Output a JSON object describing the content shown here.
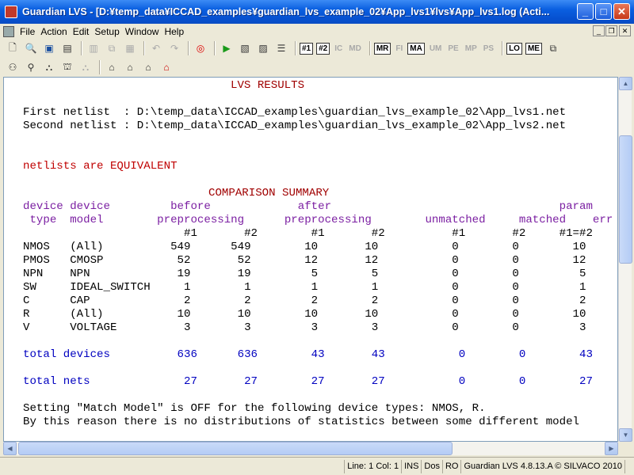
{
  "window": {
    "title": "Guardian LVS - [D:¥temp_data¥ICCAD_examples¥guardian_lvs_example_02¥App_lvs1¥lvs¥App_lvs1.log (Acti..."
  },
  "menu": [
    "File",
    "Action",
    "Edit",
    "Setup",
    "Window",
    "Help"
  ],
  "toolbar": {
    "text_buttons": [
      "#1",
      "#2",
      "IC",
      "MD",
      "MR",
      "FI",
      "MA",
      "UM",
      "PE",
      "MP",
      "PS",
      "LO",
      "ME"
    ]
  },
  "report": {
    "header": "LVS RESULTS",
    "first_netlist": "First netlist  : D:\\temp_data\\ICCAD_examples\\guardian_lvs_example_02\\App_lvs1.net",
    "second_netlist": "Second netlist : D:\\temp_data\\ICCAD_examples\\guardian_lvs_example_02\\App_lvs2.net",
    "status": "netlists are EQUIVALENT",
    "summary_title": "COMPARISON SUMMARY",
    "col_head_1": "device device         before             after                                  param",
    "col_head_2": " type  model        preprocessing      preprocessing        unmatched     matched    err",
    "col_head_3": "                        #1       #2        #1       #2          #1       #2     #1=#2    #1=",
    "rows": [
      "NMOS   (All)          549      549        10       10           0        0        10      0",
      "PMOS   CMOSP           52       52        12       12           0        0        12      0",
      "NPN    NPN             19       19         5        5           0        0         5      0",
      "SW     IDEAL_SWITCH     1        1         1        1           0        0         1      0",
      "C      CAP              2        2         2        2           0        0         2      0",
      "R      (All)           10       10        10       10           0        0        10      0",
      "V      VOLTAGE          3        3         3        3           0        0         3      0"
    ],
    "total_devices": "total devices          636      636        43       43           0        0        43",
    "total_nets": "total nets              27       27        27       27           0        0        27",
    "note_1": "Setting \"Match Model\" is OFF for the following device types: NMOS, R.",
    "note_2": "By this reason there is no distributions of statistics between some different model"
  },
  "statusbar": {
    "position": "Line: 1 Col: 1",
    "ins": "INS",
    "dos": "Dos",
    "ro": "RO",
    "product": "Guardian LVS 4.8.13.A © SILVACO 2010"
  }
}
